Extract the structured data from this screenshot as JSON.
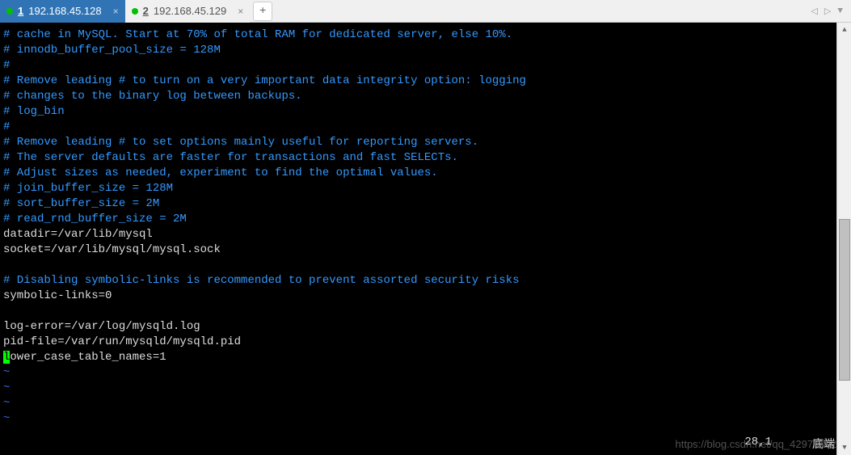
{
  "tabs": [
    {
      "num": "1",
      "label": "192.168.45.128",
      "active": true
    },
    {
      "num": "2",
      "label": "192.168.45.129",
      "active": false
    }
  ],
  "add_tab": "+",
  "nav": {
    "left": "◁",
    "right": "▷",
    "down": "▼"
  },
  "lines": [
    {
      "style": "comment",
      "text": "# cache in MySQL. Start at 70% of total RAM for dedicated server, else 10%."
    },
    {
      "style": "comment",
      "text": "# innodb_buffer_pool_size = 128M"
    },
    {
      "style": "comment",
      "text": "#"
    },
    {
      "style": "comment",
      "text": "# Remove leading # to turn on a very important data integrity option: logging"
    },
    {
      "style": "comment",
      "text": "# changes to the binary log between backups."
    },
    {
      "style": "comment",
      "text": "# log_bin"
    },
    {
      "style": "comment",
      "text": "#"
    },
    {
      "style": "comment",
      "text": "# Remove leading # to set options mainly useful for reporting servers."
    },
    {
      "style": "comment",
      "text": "# The server defaults are faster for transactions and fast SELECTs."
    },
    {
      "style": "comment",
      "text": "# Adjust sizes as needed, experiment to find the optimal values."
    },
    {
      "style": "comment",
      "text": "# join_buffer_size = 128M"
    },
    {
      "style": "comment",
      "text": "# sort_buffer_size = 2M"
    },
    {
      "style": "comment",
      "text": "# read_rnd_buffer_size = 2M"
    },
    {
      "style": "plain",
      "text": "datadir=/var/lib/mysql"
    },
    {
      "style": "plain",
      "text": "socket=/var/lib/mysql/mysql.sock"
    },
    {
      "style": "plain",
      "text": ""
    },
    {
      "style": "comment",
      "text": "# Disabling symbolic-links is recommended to prevent assorted security risks"
    },
    {
      "style": "plain",
      "text": "symbolic-links=0"
    },
    {
      "style": "plain",
      "text": ""
    },
    {
      "style": "plain",
      "text": "log-error=/var/log/mysqld.log"
    },
    {
      "style": "plain",
      "text": "pid-file=/var/run/mysqld/mysqld.pid"
    },
    {
      "style": "cursor",
      "cursor_char": "l",
      "text": "ower_case_table_names=1"
    },
    {
      "style": "tilde",
      "text": "~"
    },
    {
      "style": "tilde",
      "text": "~"
    },
    {
      "style": "tilde",
      "text": "~"
    },
    {
      "style": "tilde",
      "text": "~"
    }
  ],
  "status": {
    "pos": "28,1",
    "mode": "底端"
  },
  "watermark": "https://blog.csdn.net/qq_42979402"
}
